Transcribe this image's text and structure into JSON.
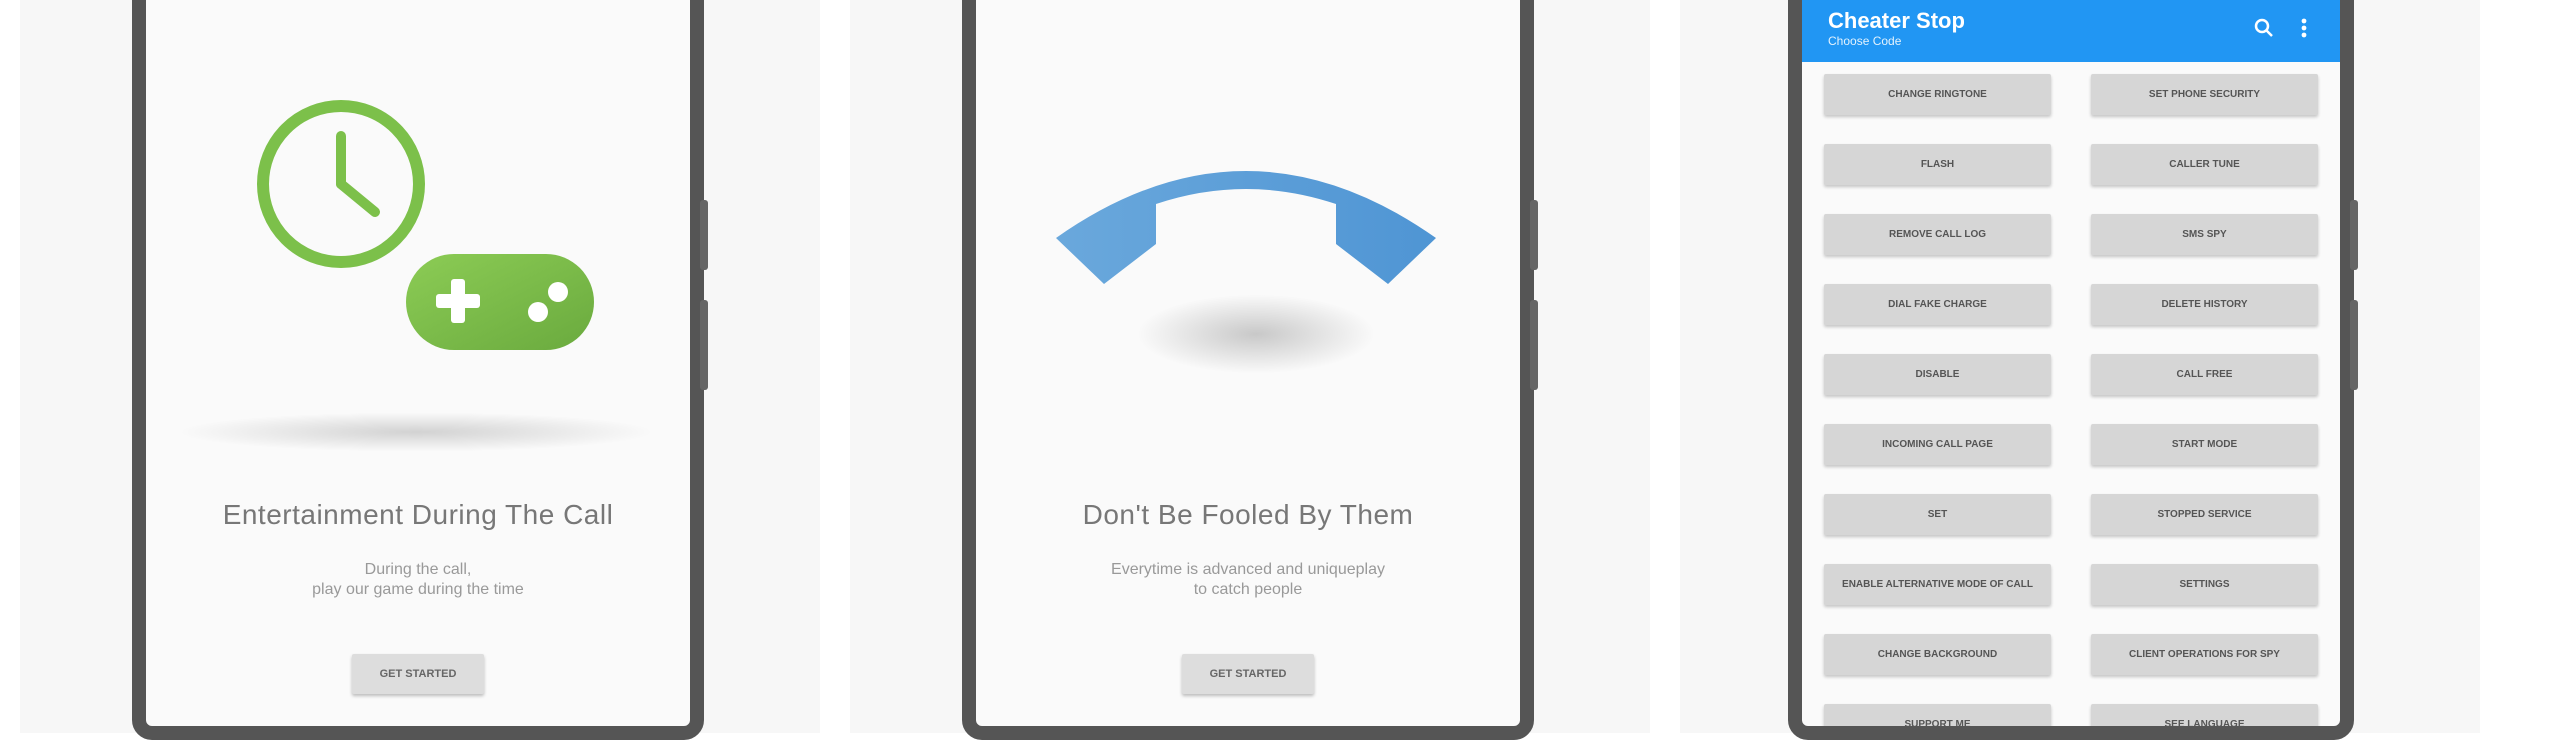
{
  "screen1": {
    "title": "Entertainment During The Call",
    "subtitle_line1": "During the call,",
    "subtitle_line2": "play our game during the time",
    "button": "GET STARTED",
    "colors": {
      "accent": "#7cc04a"
    },
    "icons": [
      "clock-icon",
      "gamepad-icon"
    ]
  },
  "screen2": {
    "title": "Don't Be Fooled By Them",
    "subtitle_line1": "Everytime is advanced and uniqueplay",
    "subtitle_line2": "to catch people",
    "button": "GET STARTED",
    "colors": {
      "accent": "#5b9fd9"
    },
    "icons": [
      "phone-handset-icon"
    ]
  },
  "screen3": {
    "app_title": "Cheater Stop",
    "app_subtitle": "Choose Code",
    "colors": {
      "appbar": "#2196f3"
    },
    "icons": [
      "search-icon",
      "more-vert-icon"
    ],
    "buttons": [
      [
        "CHANGE RINGTONE",
        "SET PHONE SECURITY"
      ],
      [
        "FLASH",
        "CALLER TUNE"
      ],
      [
        "REMOVE CALL LOG",
        "SMS SPY"
      ],
      [
        "DIAL FAKE CHARGE",
        "DELETE HISTORY"
      ],
      [
        "DISABLE",
        "CALL FREE"
      ],
      [
        "INCOMING CALL PAGE",
        "START MODE"
      ],
      [
        "SET",
        "STOPPED SERVICE"
      ],
      [
        "ENABLE ALTERNATIVE MODE OF CALL",
        "SETTINGS"
      ],
      [
        "CHANGE BACKGROUND",
        "CLIENT OPERATIONS FOR SPY"
      ],
      [
        "SUPPORT ME",
        "SEE LANGUAGE"
      ]
    ]
  }
}
